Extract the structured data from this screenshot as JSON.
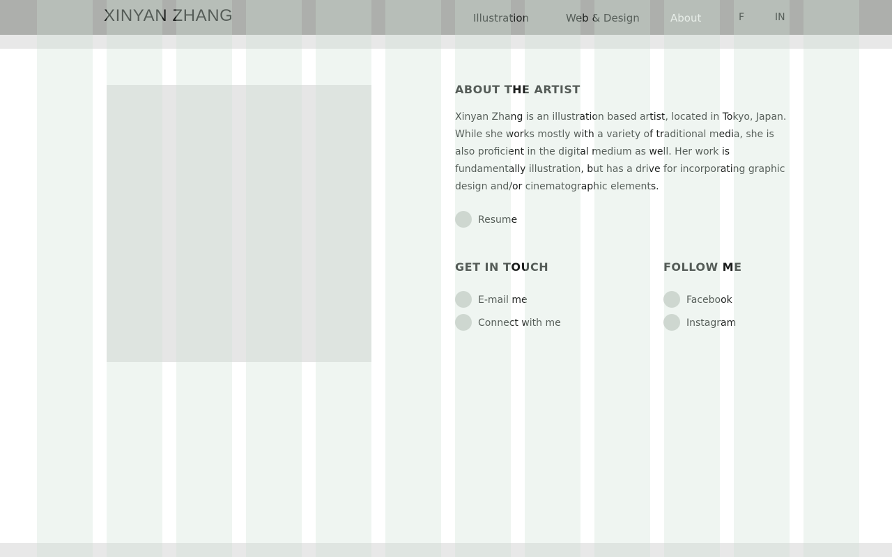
{
  "header": {
    "logo": "XINYAN ZHANG",
    "nav": {
      "illustration": "Illustration",
      "web_design": "Web & Design",
      "about": "About",
      "facebook_short": "F",
      "instagram_short": "IN"
    },
    "active_item": "About"
  },
  "about": {
    "heading": "ABOUT THE ARTIST",
    "bio": "Xinyan Zhang is an illustration based artist, located in Tokyo, Japan. While she works mostly with a variety of traditional media, she is also proficient in the digital medium as well. Her work is fundamentally illustration, but has a drive for incorporating graphic design and/or cinematographic elements.",
    "resume_label": "Resume"
  },
  "contact": {
    "heading": "GET IN TOUCH",
    "email_label": "E-mail me",
    "connect_label": "Connect with me"
  },
  "follow": {
    "heading": "FOLLOW ME",
    "facebook_label": "Facebook",
    "instagram_label": "Instagram"
  },
  "colors": {
    "header_bg": "#adafac",
    "active_nav": "#f4f4f2",
    "text": "#1e211f",
    "grid_overlay": "#cde1d2",
    "bullet": "#cfd3cf"
  },
  "icons": {
    "resume": "circle-bullet-icon",
    "email": "circle-bullet-icon",
    "connect": "circle-bullet-icon",
    "facebook": "circle-bullet-icon",
    "instagram": "circle-bullet-icon"
  }
}
